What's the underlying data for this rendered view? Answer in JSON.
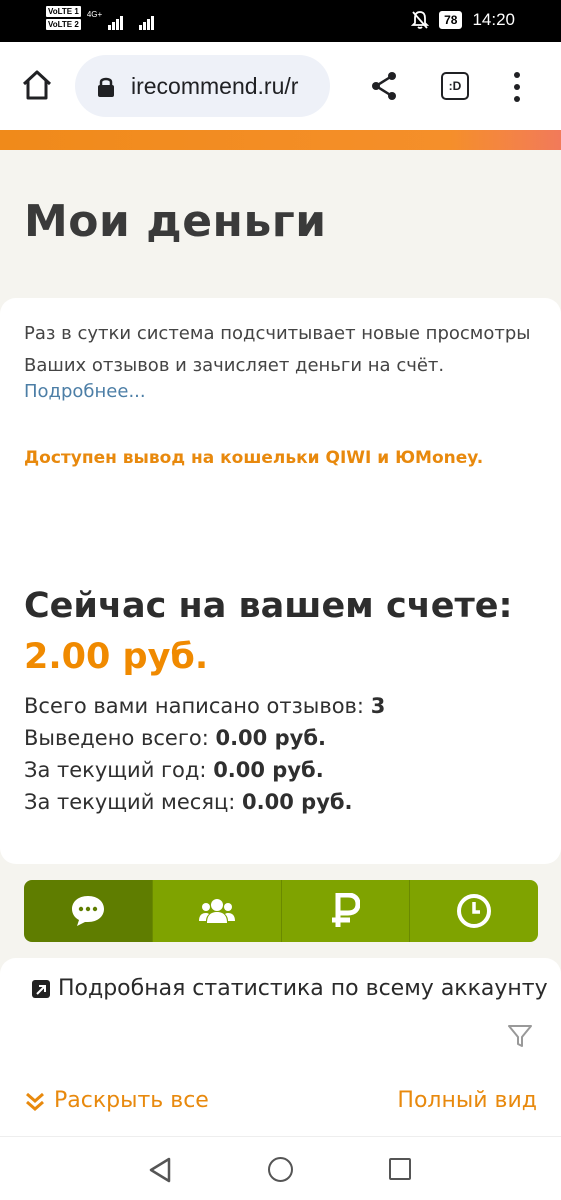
{
  "status_bar": {
    "sim1": "VoLTE 1",
    "sim2": "VoLTE 2",
    "network": "4G+",
    "battery": "78",
    "time": "14:20"
  },
  "browser": {
    "url": "irecommend.ru/r",
    "tabs_label": ":D"
  },
  "page": {
    "title": "Мои деньги",
    "info_text": "Раз в сутки система подсчитывает новые просмотры Ваших отзывов и зачисляет деньги на счёт.",
    "more_link": "Подробнее...",
    "withdraw_notice": "Доступен вывод на кошельки QIWI и ЮMoney.",
    "balance_heading": "Сейчас на вашем счете:",
    "balance_amount": "2.00 руб.",
    "stats": [
      {
        "label": "Всего вами написано отзывов:",
        "value": "3"
      },
      {
        "label": "Выведено всего:",
        "value": "0.00 руб."
      },
      {
        "label": "За текущий год:",
        "value": "0.00 руб."
      },
      {
        "label": "За текущий месяц:",
        "value": "0.00 руб."
      }
    ]
  },
  "tabs": [
    {
      "icon": "comment-icon",
      "active": true
    },
    {
      "icon": "users-icon",
      "active": false
    },
    {
      "icon": "ruble-icon",
      "active": false
    },
    {
      "icon": "clock-icon",
      "active": false
    }
  ],
  "panel": {
    "stat_link": "Подробная статистика по всему аккаунту",
    "expand_all": "Раскрыть все",
    "full_view": "Полный вид"
  },
  "colors": {
    "accent_orange": "#f08a00",
    "tab_green": "#7fa300",
    "tab_green_active": "#5f7d00",
    "link_blue": "#4c7ea6"
  }
}
